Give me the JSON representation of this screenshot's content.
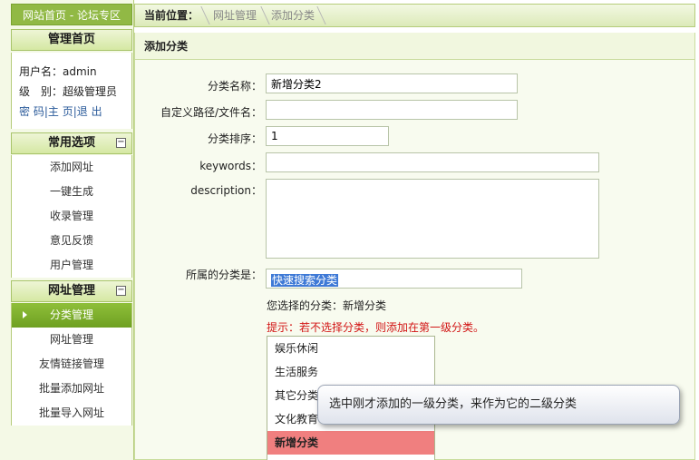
{
  "sidebar": {
    "site_link": "网站首页 - 论坛专区",
    "admin_home": "管理首页",
    "user_line": "用户名：admin",
    "level_line": "级　别：超级管理员",
    "links": {
      "password": "密 码",
      "sep1": "|",
      "home": "主 页",
      "sep2": "|",
      "logout": "退 出"
    },
    "common_section": {
      "title": "常用选项",
      "toggle": "−"
    },
    "common_items": [
      "添加网址",
      "一键生成",
      "收录管理",
      "意见反馈",
      "用户管理"
    ],
    "url_section": {
      "title": "网址管理",
      "toggle": "−"
    },
    "url_items": [
      "分类管理",
      "网址管理",
      "友情链接管理",
      "批量添加网址",
      "批量导入网址"
    ]
  },
  "header": {
    "location_label": "当前位置：",
    "breadcrumbs": [
      "网址管理",
      "添加分类"
    ]
  },
  "form": {
    "title": "添加分类",
    "name_label": "分类名称：",
    "name_value": "新增分类2",
    "path_label": "自定义路径/文件名：",
    "path_value": "",
    "order_label": "分类排序：",
    "order_value": "1",
    "keywords_label": "keywords：",
    "keywords_value": "",
    "description_label": "description：",
    "description_value": "",
    "parent_label": "所属的分类是：",
    "parent_search_value": "快速搜索分类",
    "chosen_label": "您选择的分类：",
    "chosen_value": "新增分类",
    "tip": "提示：若不选择分类，则添加在第一级分类。",
    "categories": [
      "娱乐休闲",
      "生活服务",
      "其它分类",
      "文化教育",
      "新增分类"
    ],
    "selected_category": "新增分类"
  },
  "callout": {
    "text": "选中刚才添加的一级分类，来作为它的二级分类"
  },
  "colors": {
    "accent_green": "#91b945",
    "active_item": "#7aab2a",
    "tip_red": "#d21515",
    "selected_row": "#f07f7f"
  }
}
